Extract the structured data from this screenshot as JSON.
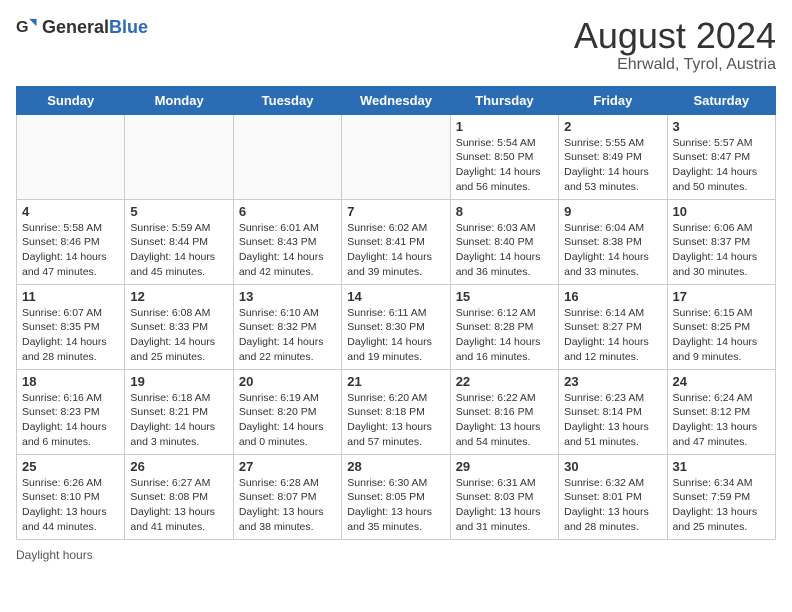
{
  "header": {
    "logo_general": "General",
    "logo_blue": "Blue",
    "title": "August 2024",
    "subtitle": "Ehrwald, Tyrol, Austria"
  },
  "days_of_week": [
    "Sunday",
    "Monday",
    "Tuesday",
    "Wednesday",
    "Thursday",
    "Friday",
    "Saturday"
  ],
  "weeks": [
    [
      {
        "day": "",
        "info": ""
      },
      {
        "day": "",
        "info": ""
      },
      {
        "day": "",
        "info": ""
      },
      {
        "day": "",
        "info": ""
      },
      {
        "day": "1",
        "info": "Sunrise: 5:54 AM\nSunset: 8:50 PM\nDaylight: 14 hours and 56 minutes."
      },
      {
        "day": "2",
        "info": "Sunrise: 5:55 AM\nSunset: 8:49 PM\nDaylight: 14 hours and 53 minutes."
      },
      {
        "day": "3",
        "info": "Sunrise: 5:57 AM\nSunset: 8:47 PM\nDaylight: 14 hours and 50 minutes."
      }
    ],
    [
      {
        "day": "4",
        "info": "Sunrise: 5:58 AM\nSunset: 8:46 PM\nDaylight: 14 hours and 47 minutes."
      },
      {
        "day": "5",
        "info": "Sunrise: 5:59 AM\nSunset: 8:44 PM\nDaylight: 14 hours and 45 minutes."
      },
      {
        "day": "6",
        "info": "Sunrise: 6:01 AM\nSunset: 8:43 PM\nDaylight: 14 hours and 42 minutes."
      },
      {
        "day": "7",
        "info": "Sunrise: 6:02 AM\nSunset: 8:41 PM\nDaylight: 14 hours and 39 minutes."
      },
      {
        "day": "8",
        "info": "Sunrise: 6:03 AM\nSunset: 8:40 PM\nDaylight: 14 hours and 36 minutes."
      },
      {
        "day": "9",
        "info": "Sunrise: 6:04 AM\nSunset: 8:38 PM\nDaylight: 14 hours and 33 minutes."
      },
      {
        "day": "10",
        "info": "Sunrise: 6:06 AM\nSunset: 8:37 PM\nDaylight: 14 hours and 30 minutes."
      }
    ],
    [
      {
        "day": "11",
        "info": "Sunrise: 6:07 AM\nSunset: 8:35 PM\nDaylight: 14 hours and 28 minutes."
      },
      {
        "day": "12",
        "info": "Sunrise: 6:08 AM\nSunset: 8:33 PM\nDaylight: 14 hours and 25 minutes."
      },
      {
        "day": "13",
        "info": "Sunrise: 6:10 AM\nSunset: 8:32 PM\nDaylight: 14 hours and 22 minutes."
      },
      {
        "day": "14",
        "info": "Sunrise: 6:11 AM\nSunset: 8:30 PM\nDaylight: 14 hours and 19 minutes."
      },
      {
        "day": "15",
        "info": "Sunrise: 6:12 AM\nSunset: 8:28 PM\nDaylight: 14 hours and 16 minutes."
      },
      {
        "day": "16",
        "info": "Sunrise: 6:14 AM\nSunset: 8:27 PM\nDaylight: 14 hours and 12 minutes."
      },
      {
        "day": "17",
        "info": "Sunrise: 6:15 AM\nSunset: 8:25 PM\nDaylight: 14 hours and 9 minutes."
      }
    ],
    [
      {
        "day": "18",
        "info": "Sunrise: 6:16 AM\nSunset: 8:23 PM\nDaylight: 14 hours and 6 minutes."
      },
      {
        "day": "19",
        "info": "Sunrise: 6:18 AM\nSunset: 8:21 PM\nDaylight: 14 hours and 3 minutes."
      },
      {
        "day": "20",
        "info": "Sunrise: 6:19 AM\nSunset: 8:20 PM\nDaylight: 14 hours and 0 minutes."
      },
      {
        "day": "21",
        "info": "Sunrise: 6:20 AM\nSunset: 8:18 PM\nDaylight: 13 hours and 57 minutes."
      },
      {
        "day": "22",
        "info": "Sunrise: 6:22 AM\nSunset: 8:16 PM\nDaylight: 13 hours and 54 minutes."
      },
      {
        "day": "23",
        "info": "Sunrise: 6:23 AM\nSunset: 8:14 PM\nDaylight: 13 hours and 51 minutes."
      },
      {
        "day": "24",
        "info": "Sunrise: 6:24 AM\nSunset: 8:12 PM\nDaylight: 13 hours and 47 minutes."
      }
    ],
    [
      {
        "day": "25",
        "info": "Sunrise: 6:26 AM\nSunset: 8:10 PM\nDaylight: 13 hours and 44 minutes."
      },
      {
        "day": "26",
        "info": "Sunrise: 6:27 AM\nSunset: 8:08 PM\nDaylight: 13 hours and 41 minutes."
      },
      {
        "day": "27",
        "info": "Sunrise: 6:28 AM\nSunset: 8:07 PM\nDaylight: 13 hours and 38 minutes."
      },
      {
        "day": "28",
        "info": "Sunrise: 6:30 AM\nSunset: 8:05 PM\nDaylight: 13 hours and 35 minutes."
      },
      {
        "day": "29",
        "info": "Sunrise: 6:31 AM\nSunset: 8:03 PM\nDaylight: 13 hours and 31 minutes."
      },
      {
        "day": "30",
        "info": "Sunrise: 6:32 AM\nSunset: 8:01 PM\nDaylight: 13 hours and 28 minutes."
      },
      {
        "day": "31",
        "info": "Sunrise: 6:34 AM\nSunset: 7:59 PM\nDaylight: 13 hours and 25 minutes."
      }
    ]
  ],
  "footer": {
    "note": "Daylight hours"
  }
}
